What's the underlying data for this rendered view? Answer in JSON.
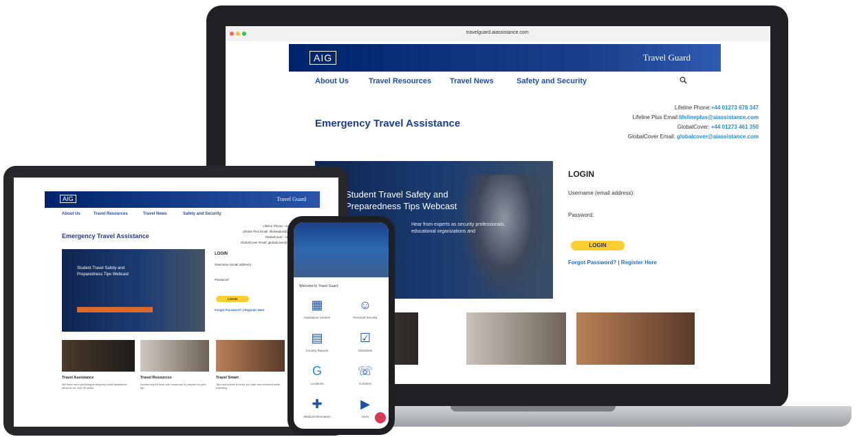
{
  "laptop": {
    "browser": {
      "url": "travelguard.aiassistance.com"
    },
    "brand": {
      "logo": "AIG",
      "product": "Travel Guard"
    },
    "nav": [
      "About Us",
      "Travel Resources",
      "Travel News",
      "Safety and Security"
    ],
    "search_icon": "search-icon",
    "page_title": "Emergency Travel Assistance",
    "contacts": [
      {
        "label": "Lifeline Phone:",
        "value": "+44 01273 678 347"
      },
      {
        "label": "Lifeline Plus Email:",
        "value": "lifelineplus@aiassistance.com"
      },
      {
        "label": "GlobalCover: ",
        "value": "+44 01273 461 350"
      },
      {
        "label": "GlobalCover Email: ",
        "value": "globalcover@aiassistance.com"
      }
    ],
    "hero": {
      "title": "Student Travel Safety and Preparedness Tips Webcast",
      "subtitle": "Hear from experts as security professionals, educational organizations and"
    },
    "login": {
      "title": "LOGIN",
      "username_label": "Username (email address):",
      "password_label": "Password:",
      "button": "LOGIN",
      "links": "Forgot Password? | Register Here"
    }
  },
  "tablet": {
    "brand": {
      "logo": "AIG",
      "product": "Travel Guard"
    },
    "nav": [
      "About Us",
      "Travel Resources",
      "Travel News",
      "Safety and Security"
    ],
    "page_title": "Emergency Travel Assistance",
    "contacts": [
      "Lifeline Phone: +44 01273 678 347",
      "Lifeline Plus Email: lifelineplus@aiassistance.com",
      "GlobalCover: +44 01273 461 350",
      "GlobalCover Email: globalcover@aiassistance.com"
    ],
    "hero": {
      "title": "Student Travel Safety and Preparedness Tips Webcast"
    },
    "login": {
      "title": "LOGIN",
      "username_label": "Username (email address):",
      "password_label": "Password:",
      "button": "LOGIN",
      "links": "Forgot Password? | Register Here"
    },
    "cards": [
      {
        "title": "Travel Assistance",
        "text": "We have been providing emergency travel assistance services for over 30 years."
      },
      {
        "title": "Travel Resources",
        "text": "Access helpful tools and resources to prepare for your trip."
      },
      {
        "title": "Travel Smart",
        "text": "Tips and advice to keep you safe and informed while travelling."
      }
    ]
  },
  "phone": {
    "welcome": "Welcome to Travel Guard",
    "tiles": [
      {
        "label": "Assistance Centers",
        "icon": "building-icon"
      },
      {
        "label": "Personal Security",
        "icon": "person-icon"
      },
      {
        "label": "Country Reports",
        "icon": "document-icon"
      },
      {
        "label": "Checklists",
        "icon": "checklist-icon"
      },
      {
        "label": "Locations",
        "icon": "globe-icon"
      },
      {
        "label": "Contacts",
        "icon": "contacts-icon"
      },
      {
        "label": "Medical Information",
        "icon": "medical-icon"
      },
      {
        "label": "Alerts",
        "icon": "play-icon"
      }
    ]
  }
}
